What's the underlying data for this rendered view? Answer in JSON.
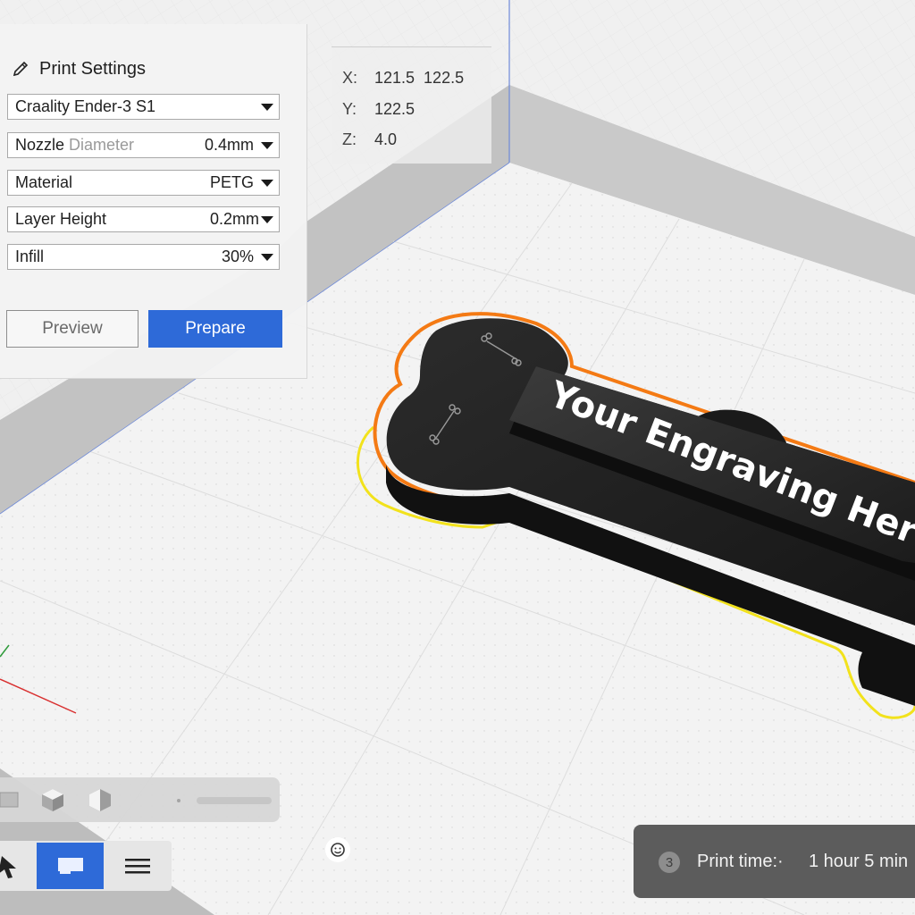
{
  "print_settings": {
    "title": "Print Settings",
    "printer": "Craality Ender-3 S1",
    "nozzle": {
      "label": "Nozzle",
      "label_muted": " Diameter",
      "value": "0.4mm"
    },
    "material": {
      "label": "Material",
      "value": "PETG"
    },
    "layer_height": {
      "label": "Layer Height",
      "value": "0.2mm"
    },
    "infill": {
      "label": "Infill",
      "value": "30%"
    },
    "preview_label": "Preview",
    "prepare_label": "Prepare"
  },
  "coordinates": {
    "x_label": "X:",
    "x_value": "121.5  122.5",
    "y_label": "Y:",
    "y_value": "122.5",
    "z_label": "Z:",
    "z_value": "4.0"
  },
  "model": {
    "engraving_text": "Your Engraving Here"
  },
  "status": {
    "step_number": "3",
    "label": "Print time:·",
    "value": "1 hour 5 min"
  },
  "colors": {
    "accent": "#2e6ad8",
    "model": "#161616",
    "brim_outline": "#f47a14",
    "skirt_outline": "#f2e21c"
  },
  "icons": [
    "pencil-icon",
    "dropdown-caret-icon",
    "view-box-icon",
    "isometric-view-icon",
    "side-view-icon",
    "slider-icon",
    "move-tool-icon",
    "display-icon",
    "menu-icon",
    "face-icon"
  ]
}
